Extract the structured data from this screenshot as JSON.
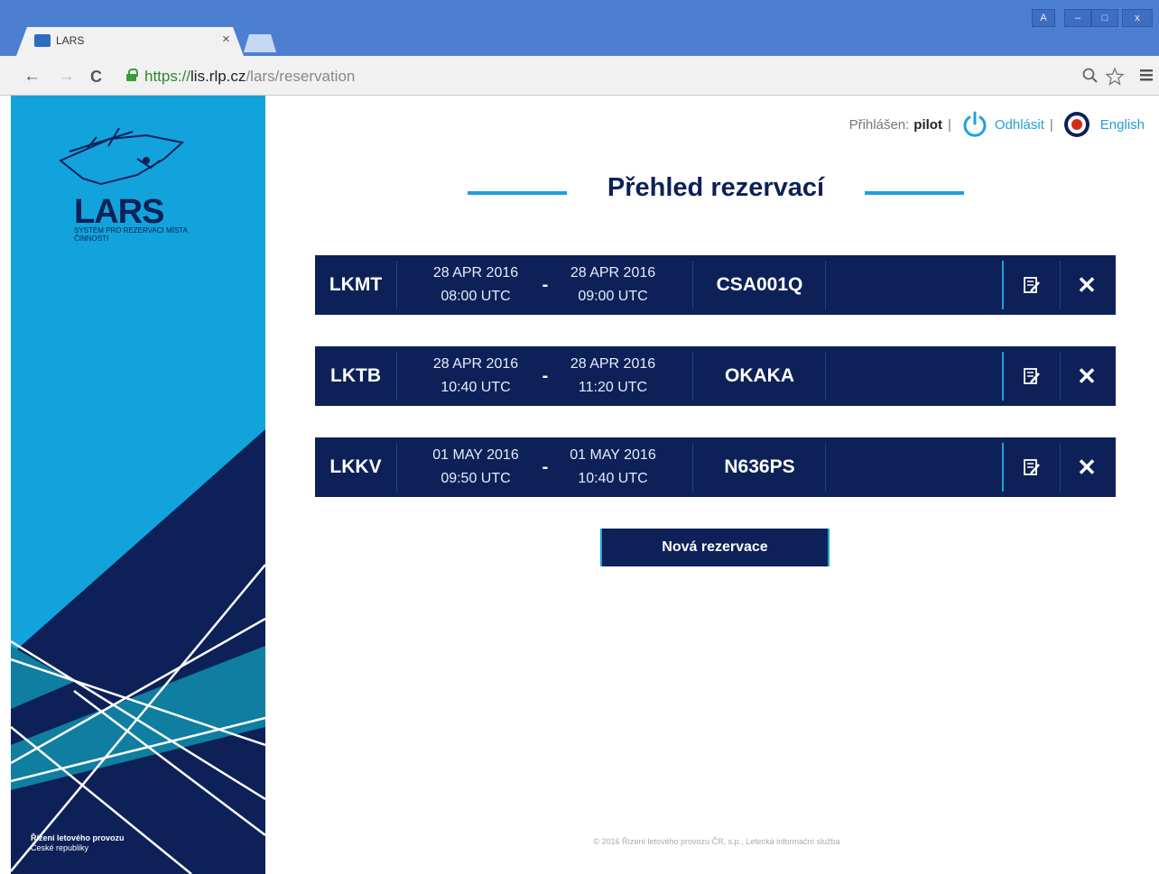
{
  "browser": {
    "tab_title": "LARS",
    "tab_close": "×",
    "url_scheme": "https://",
    "url_host": "lis.rlp.cz",
    "url_path": "/lars/reservation",
    "back": "←",
    "forward": "→",
    "reload": "C",
    "zoom_icon": "magnifier-icon",
    "star_icon": "star-icon",
    "menu_icon": "menu-icon",
    "window_buttons": [
      "A",
      "–",
      "□",
      "x"
    ]
  },
  "sidebar": {
    "logo_title": "LARS",
    "logo_subtitle": "Systém pro rezervaci místa činnosti",
    "org_line1": "Řízení letového provozu",
    "org_line2": "České republiky"
  },
  "userbar": {
    "logged_label": "Přihlášen:",
    "username": "pilot",
    "separator": "|",
    "logout_label": "Odhlásit",
    "language_label": "English"
  },
  "page": {
    "title": "Přehled rezervací",
    "new_button_label": "Nová rezervace",
    "copyright": "© 2016 Řízení letového provozu ČR, s.p., Letecká informační služba"
  },
  "reservations": [
    {
      "airport": "LKMT",
      "from_date": "28 APR 2016",
      "from_time": "08:00 UTC",
      "dash": "-",
      "to_date": "28 APR 2016",
      "to_time": "09:00 UTC",
      "callsign": "CSA001Q"
    },
    {
      "airport": "LKTB",
      "from_date": "28 APR 2016",
      "from_time": "10:40 UTC",
      "dash": "-",
      "to_date": "28 APR 2016",
      "to_time": "11:20 UTC",
      "callsign": "OKAKA"
    },
    {
      "airport": "LKKV",
      "from_date": "01 MAY 2016",
      "from_time": "09:50 UTC",
      "dash": "-",
      "to_date": "01 MAY 2016",
      "to_time": "10:40 UTC",
      "callsign": "N636PS"
    }
  ],
  "colors": {
    "navy": "#0d2158",
    "accent": "#1fa0dd",
    "sidebar_light": "#12a3dc",
    "chrome": "#4d7fd1"
  }
}
